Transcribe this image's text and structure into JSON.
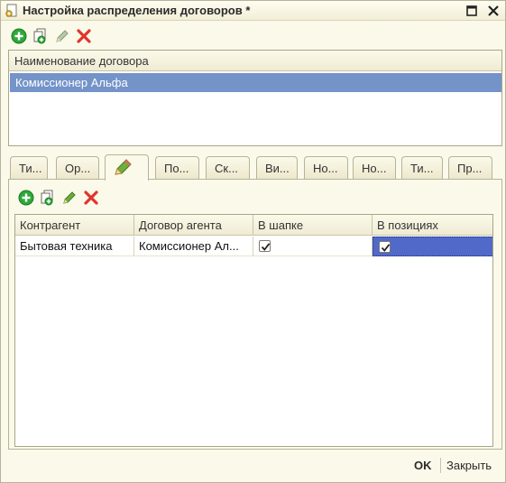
{
  "window": {
    "title": "Настройка распределения договоров *"
  },
  "upper_list": {
    "column_header": "Наименование договора",
    "rows": [
      "Комиссионер Альфа"
    ]
  },
  "tabs": [
    {
      "label": "Ти..."
    },
    {
      "label": "Ор..."
    },
    {
      "label": ""
    },
    {
      "label": "По..."
    },
    {
      "label": "Ск..."
    },
    {
      "label": "Ви..."
    },
    {
      "label": "Но..."
    },
    {
      "label": "Но..."
    },
    {
      "label": "Ти..."
    },
    {
      "label": "Пр..."
    }
  ],
  "lower_table": {
    "headers": [
      "Контрагент",
      "Договор агента",
      "В шапке",
      "В позициях"
    ],
    "rows": [
      {
        "counterparty": "Бытовая техника",
        "agent_contract": "Комиссионер Ал...",
        "in_header": true,
        "in_positions": true
      }
    ]
  },
  "footer": {
    "ok_label": "OK",
    "close_label": "Закрыть"
  },
  "colors": {
    "background": "#fbf9ea",
    "selected_row": "#7393c9",
    "selected_cell": "#5169c8",
    "add_green": "#2ea83a",
    "delete_red": "#e0352b"
  }
}
